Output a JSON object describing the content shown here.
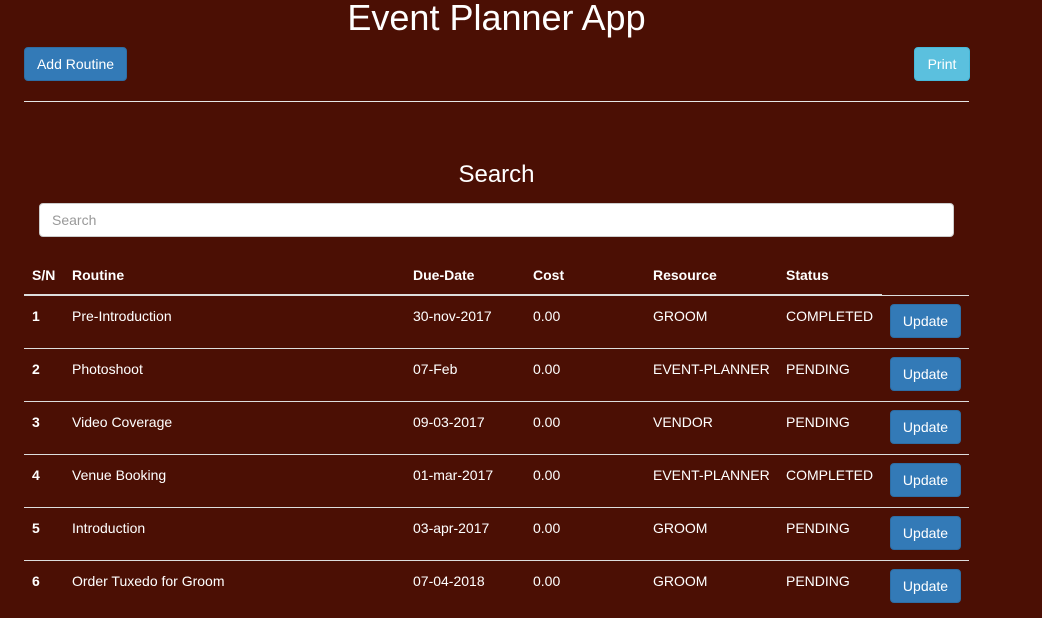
{
  "app": {
    "title": "Event Planner App"
  },
  "toolbar": {
    "add_label": "Add Routine",
    "print_label": "Print"
  },
  "search": {
    "heading": "Search",
    "placeholder": "Search",
    "value": ""
  },
  "table": {
    "headers": [
      "S/N",
      "Routine",
      "Due-Date",
      "Cost",
      "Resource",
      "Status"
    ],
    "rows": [
      {
        "sn": "1",
        "routine": "Pre-Introduction",
        "due": "30-nov-2017",
        "cost": "0.00",
        "resource": "GROOM",
        "status": "COMPLETED",
        "action": "Update"
      },
      {
        "sn": "2",
        "routine": "Photoshoot",
        "due": "07-Feb",
        "cost": "0.00",
        "resource": "EVENT-PLANNER",
        "status": "PENDING",
        "action": "Update"
      },
      {
        "sn": "3",
        "routine": "Video Coverage",
        "due": "09-03-2017",
        "cost": "0.00",
        "resource": "VENDOR",
        "status": "PENDING",
        "action": "Update"
      },
      {
        "sn": "4",
        "routine": "Venue Booking",
        "due": "01-mar-2017",
        "cost": "0.00",
        "resource": "EVENT-PLANNER",
        "status": "COMPLETED",
        "action": "Update"
      },
      {
        "sn": "5",
        "routine": "Introduction",
        "due": "03-apr-2017",
        "cost": "0.00",
        "resource": "GROOM",
        "status": "PENDING",
        "action": "Update"
      },
      {
        "sn": "6",
        "routine": "Order Tuxedo for Groom",
        "due": "07-04-2018",
        "cost": "0.00",
        "resource": "GROOM",
        "status": "PENDING",
        "action": "Update"
      }
    ]
  },
  "colors": {
    "background": "#4b0f04",
    "primary": "#337ab7",
    "info": "#5bc0de",
    "text": "#ffffff"
  }
}
